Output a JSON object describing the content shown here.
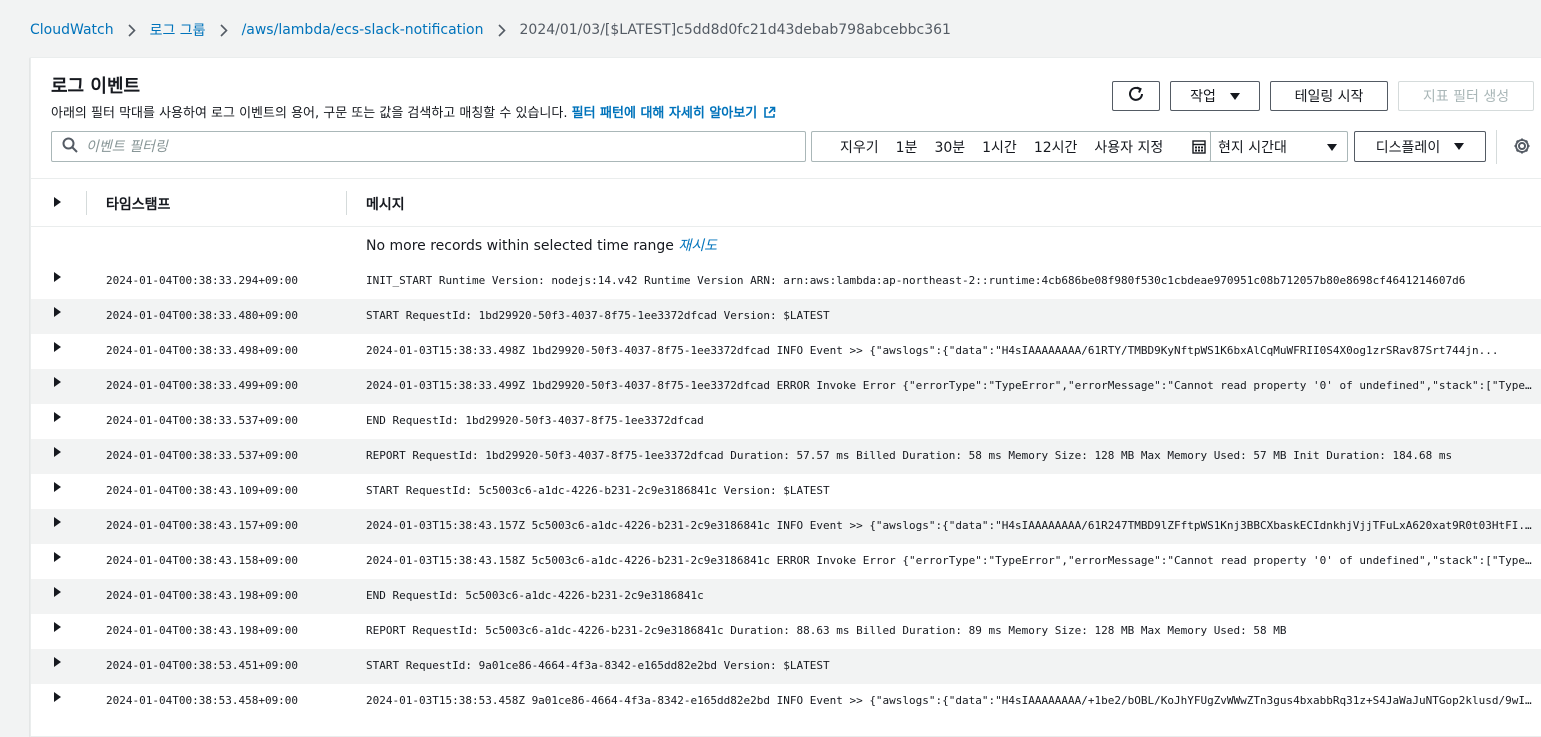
{
  "breadcrumb": {
    "items": [
      "CloudWatch",
      "로그 그룹",
      "/aws/lambda/ecs-slack-notification"
    ],
    "current": "2024/01/03/[$LATEST]c5dd8d0fc21d43debab798abcebbc361"
  },
  "header": {
    "title": "로그 이벤트",
    "subtitle": "아래의 필터 막대를 사용하여 로그 이벤트의 용어, 구문 또는 값을 검색하고 매칭할 수 있습니다.",
    "learn_link": "필터 패턴에 대해 자세히 알아보기"
  },
  "toolbar": {
    "actions_label": "작업",
    "tail_label": "테일링 시작",
    "metric_filter_label": "지표 필터 생성",
    "filter_placeholder": "이벤트 필터링",
    "range": [
      "지우기",
      "1분",
      "30분",
      "1시간",
      "12시간",
      "사용자 지정"
    ],
    "timezone": "현지 시간대",
    "display_label": "디스플레이"
  },
  "table": {
    "col_timestamp": "타임스탬프",
    "col_message": "메시지",
    "no_more": "No more records within selected time range",
    "retry": "재시도",
    "rows": [
      {
        "ts": "2024-01-04T00:38:33.294+09:00",
        "msg": "INIT_START Runtime Version: nodejs:14.v42 Runtime Version ARN: arn:aws:lambda:ap-northeast-2::runtime:4cb686be08f980f530c1cbdeae970951c08b712057b80e8698cf4641214607d6"
      },
      {
        "ts": "2024-01-04T00:38:33.480+09:00",
        "msg": "START RequestId: 1bd29920-50f3-4037-8f75-1ee3372dfcad Version: $LATEST"
      },
      {
        "ts": "2024-01-04T00:38:33.498+09:00",
        "msg": "2024-01-03T15:38:33.498Z 1bd29920-50f3-4037-8f75-1ee3372dfcad INFO Event >> {\"awslogs\":{\"data\":\"H4sIAAAAAAAA/61RTY/TMBD9KyNftpWS1K6bxAlCqMuWFRII0S4X0og1zrSRav87Srt744jn..."
      },
      {
        "ts": "2024-01-04T00:38:33.499+09:00",
        "msg": "2024-01-03T15:38:33.499Z 1bd29920-50f3-4037-8f75-1ee3372dfcad ERROR Invoke Error {\"errorType\":\"TypeError\",\"errorMessage\":\"Cannot read property '0' of undefined\",\"stack\":[\"TypeE..."
      },
      {
        "ts": "2024-01-04T00:38:33.537+09:00",
        "msg": "END RequestId: 1bd29920-50f3-4037-8f75-1ee3372dfcad"
      },
      {
        "ts": "2024-01-04T00:38:33.537+09:00",
        "msg": "REPORT RequestId: 1bd29920-50f3-4037-8f75-1ee3372dfcad Duration: 57.57 ms Billed Duration: 58 ms Memory Size: 128 MB Max Memory Used: 57 MB Init Duration: 184.68 ms"
      },
      {
        "ts": "2024-01-04T00:38:43.109+09:00",
        "msg": "START RequestId: 5c5003c6-a1dc-4226-b231-2c9e3186841c Version: $LATEST"
      },
      {
        "ts": "2024-01-04T00:38:43.157+09:00",
        "msg": "2024-01-03T15:38:43.157Z 5c5003c6-a1dc-4226-b231-2c9e3186841c INFO Event >> {\"awslogs\":{\"data\":\"H4sIAAAAAAAA/61R247TMBD9lZFftpWS1Knj3BBCXbaskECIdnkhjVjjTFuLxA620xat9R0t03HtFI..."
      },
      {
        "ts": "2024-01-04T00:38:43.158+09:00",
        "msg": "2024-01-03T15:38:43.158Z 5c5003c6-a1dc-4226-b231-2c9e3186841c ERROR Invoke Error {\"errorType\":\"TypeError\",\"errorMessage\":\"Cannot read property '0' of undefined\",\"stack\":[\"TypeE..."
      },
      {
        "ts": "2024-01-04T00:38:43.198+09:00",
        "msg": "END RequestId: 5c5003c6-a1dc-4226-b231-2c9e3186841c"
      },
      {
        "ts": "2024-01-04T00:38:43.198+09:00",
        "msg": "REPORT RequestId: 5c5003c6-a1dc-4226-b231-2c9e3186841c Duration: 88.63 ms Billed Duration: 89 ms Memory Size: 128 MB Max Memory Used: 58 MB"
      },
      {
        "ts": "2024-01-04T00:38:53.451+09:00",
        "msg": "START RequestId: 9a01ce86-4664-4f3a-8342-e165dd82e2bd Version: $LATEST"
      },
      {
        "ts": "2024-01-04T00:38:53.458+09:00",
        "msg": "2024-01-03T15:38:53.458Z 9a01ce86-4664-4f3a-8342-e165dd82e2bd INFO Event >> {\"awslogs\":{\"data\":\"H4sIAAAAAAAA/+1be2/bOBL/KoJhYFUgZvWWwZTn3gus4bxabbRq31z+S4JaWaJuNTGop2klusd/9wIfk..."
      }
    ]
  }
}
